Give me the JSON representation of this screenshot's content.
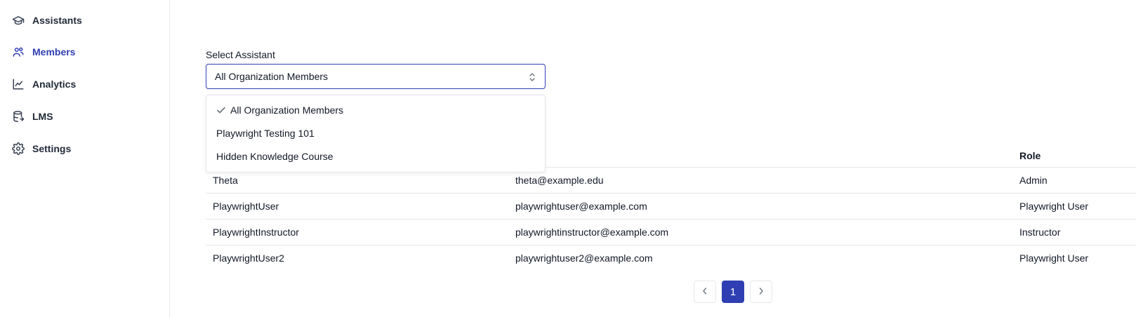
{
  "sidebar": {
    "items": [
      {
        "label": "Assistants",
        "icon": "graduation-cap-icon",
        "active": false
      },
      {
        "label": "Members",
        "icon": "users-icon",
        "active": true
      },
      {
        "label": "Analytics",
        "icon": "chart-line-icon",
        "active": false
      },
      {
        "label": "LMS",
        "icon": "database-icon",
        "active": false
      },
      {
        "label": "Settings",
        "icon": "gear-icon",
        "active": false
      }
    ]
  },
  "select": {
    "label": "Select Assistant",
    "value": "All Organization Members",
    "options": [
      {
        "label": "All Organization Members",
        "selected": true
      },
      {
        "label": "Playwright Testing 101",
        "selected": false
      },
      {
        "label": "Hidden Knowledge Course",
        "selected": false
      }
    ]
  },
  "table": {
    "headers": [
      "",
      "",
      "Role"
    ],
    "rows": [
      {
        "name": "Theta",
        "email": "theta@example.edu",
        "role": "Admin"
      },
      {
        "name": "PlaywrightUser",
        "email": "playwrightuser@example.com",
        "role": "Playwright User"
      },
      {
        "name": "PlaywrightInstructor",
        "email": "playwrightinstructor@example.com",
        "role": "Instructor"
      },
      {
        "name": "PlaywrightUser2",
        "email": "playwrightuser2@example.com",
        "role": "Playwright User"
      }
    ]
  },
  "pagination": {
    "current_page": "1"
  },
  "colors": {
    "accent": "#2f3fb3",
    "border": "#e5e7eb"
  }
}
